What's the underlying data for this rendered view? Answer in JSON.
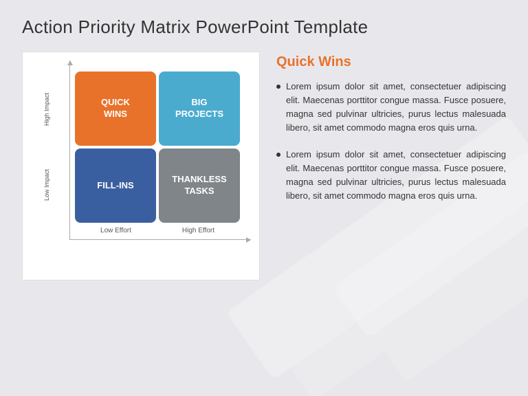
{
  "page": {
    "title": "Action Priority Matrix PowerPoint Template"
  },
  "matrix": {
    "cells": [
      {
        "id": "quick-wins",
        "label": "QUICK\nWINS",
        "colorClass": "cell-quick-wins"
      },
      {
        "id": "big-projects",
        "label": "BIG\nPROJECTS",
        "colorClass": "cell-big-projects"
      },
      {
        "id": "fill-ins",
        "label": "FILL-INS",
        "colorClass": "cell-fill-ins"
      },
      {
        "id": "thankless-tasks",
        "label": "THANKLESS\nTASKS",
        "colorClass": "cell-thankless-tasks"
      }
    ],
    "xLabels": [
      "Low Effort",
      "High Effort"
    ],
    "yLabels": [
      "High Impact",
      "Low Impact"
    ]
  },
  "description": {
    "title": "Quick Wins",
    "bullets": [
      "Lorem ipsum dolor sit amet, consectetuer adipiscing elit. Maecenas porttitor congue massa. Fusce posuere, magna sed pulvinar ultricies, purus lectus malesuada libero, sit amet commodo magna eros quis urna.",
      "Lorem ipsum dolor sit amet, consectetuer adipiscing elit. Maecenas porttitor congue massa. Fusce posuere, magna sed pulvinar ultricies, purus lectus malesuada libero, sit amet commodo magna eros quis urna."
    ]
  }
}
